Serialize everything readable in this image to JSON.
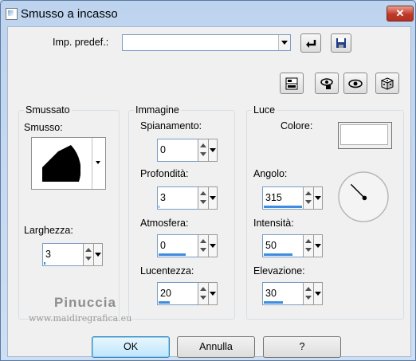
{
  "window": {
    "title": "Smusso a incasso",
    "close_label": "✕"
  },
  "preset": {
    "label": "Imp. predef.:",
    "value": ""
  },
  "smussato": {
    "group_title": "Smussato",
    "smusso_label": "Smusso:",
    "larghezza_label": "Larghezza:",
    "larghezza_value": "3",
    "larghezza_fill": 0.05
  },
  "immagine": {
    "group_title": "Immagine",
    "spianamento": {
      "label": "Spianamento:",
      "value": "0",
      "fill": 0.0
    },
    "profondita": {
      "label": "Profondità:",
      "value": "3",
      "fill": 0.03
    },
    "atmosfera": {
      "label": "Atmosfera:",
      "value": "0",
      "fill": 0.7
    },
    "lucentezza": {
      "label": "Lucentezza:",
      "value": "20",
      "fill": 0.3
    }
  },
  "luce": {
    "group_title": "Luce",
    "colore_label": "Colore:",
    "colore_value": "#ffffff",
    "angolo": {
      "label": "Angolo:",
      "value": "315",
      "fill": 1.0
    },
    "intensita": {
      "label": "Intensità:",
      "value": "50",
      "fill": 0.75
    },
    "elevazione": {
      "label": "Elevazione:",
      "value": "30",
      "fill": 0.5
    }
  },
  "buttons": {
    "ok": "OK",
    "cancel": "Annulla",
    "help": "?"
  },
  "watermark": {
    "line1": "Pinuccia",
    "line2": "www.maidiregrafica.eu"
  },
  "accent": "#3e8be0"
}
